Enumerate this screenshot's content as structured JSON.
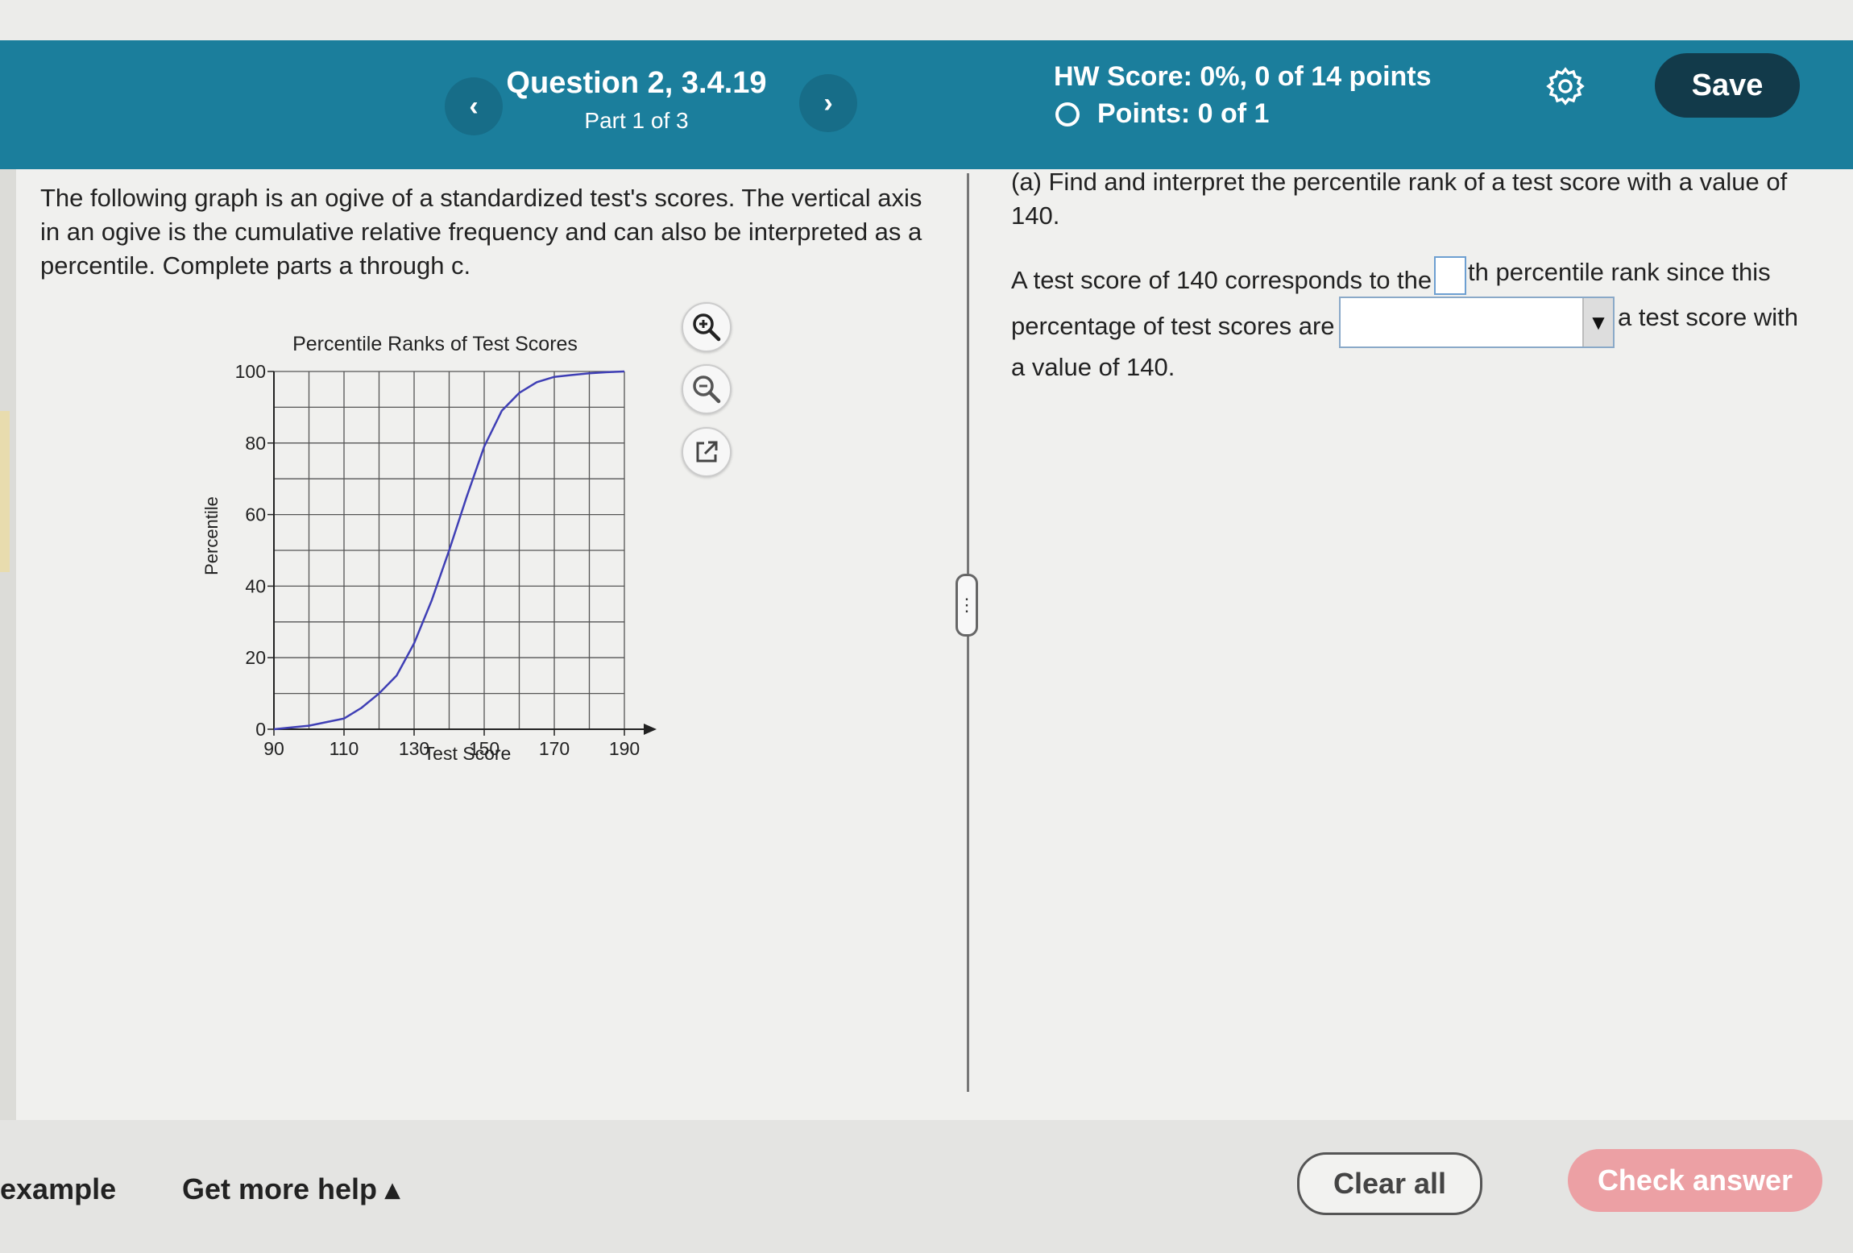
{
  "header": {
    "question_title": "Question 2, 3.4.19",
    "part_label": "Part 1 of 3",
    "hw_score": "HW Score: 0%, 0 of 14 points",
    "points": "Points: 0 of 1",
    "save_label": "Save",
    "prev_icon": "chevron-left-icon",
    "next_icon": "chevron-right-icon",
    "settings_icon": "gear-icon",
    "accent_color": "#1b7e9c",
    "save_color": "#123a4a"
  },
  "left": {
    "intro": "The following graph is an ogive of a standardized test's scores. The vertical axis in an ogive is the cumulative relative frequency and can also be interpreted as a percentile. Complete parts a through c.",
    "tools": [
      "zoom-in-icon",
      "zoom-out-icon",
      "external-link-icon"
    ]
  },
  "chart_data": {
    "type": "line",
    "title": "Percentile Ranks of Test Scores",
    "xlabel": "Test Score",
    "ylabel": "Percentile",
    "xlim": [
      90,
      190
    ],
    "ylim": [
      0,
      100
    ],
    "x_ticks": [
      90,
      110,
      130,
      150,
      170,
      190
    ],
    "y_ticks": [
      0,
      20,
      40,
      60,
      80,
      100
    ],
    "grid": true,
    "line_color": "#3f3fb5",
    "series": [
      {
        "x": [
          90,
          95,
          100,
          105,
          110,
          115,
          120,
          125,
          130,
          135,
          140,
          145,
          150,
          155,
          160,
          165,
          170,
          175,
          180,
          185,
          190
        ],
        "y": [
          0,
          0.5,
          1,
          2,
          3,
          6,
          10,
          15,
          24,
          36,
          50,
          65,
          79,
          89,
          94,
          97,
          98.5,
          99,
          99.5,
          99.8,
          100
        ]
      }
    ]
  },
  "right": {
    "question": "(a) Find and interpret the percentile rank of a test score with a value of 140.",
    "line1_pre": "A test score of 140 corresponds to the",
    "line1_post": "th percentile rank since this",
    "line2_pre": "percentage of test scores are",
    "line2_post": "a test score with",
    "line3": "a value of 140.",
    "blank_value": "",
    "dropdown_value": ""
  },
  "footer": {
    "example_label": "example",
    "help_label": "Get more help ▴",
    "clear_label": "Clear all",
    "check_label": "Check answer",
    "check_color": "#eca0a4"
  }
}
